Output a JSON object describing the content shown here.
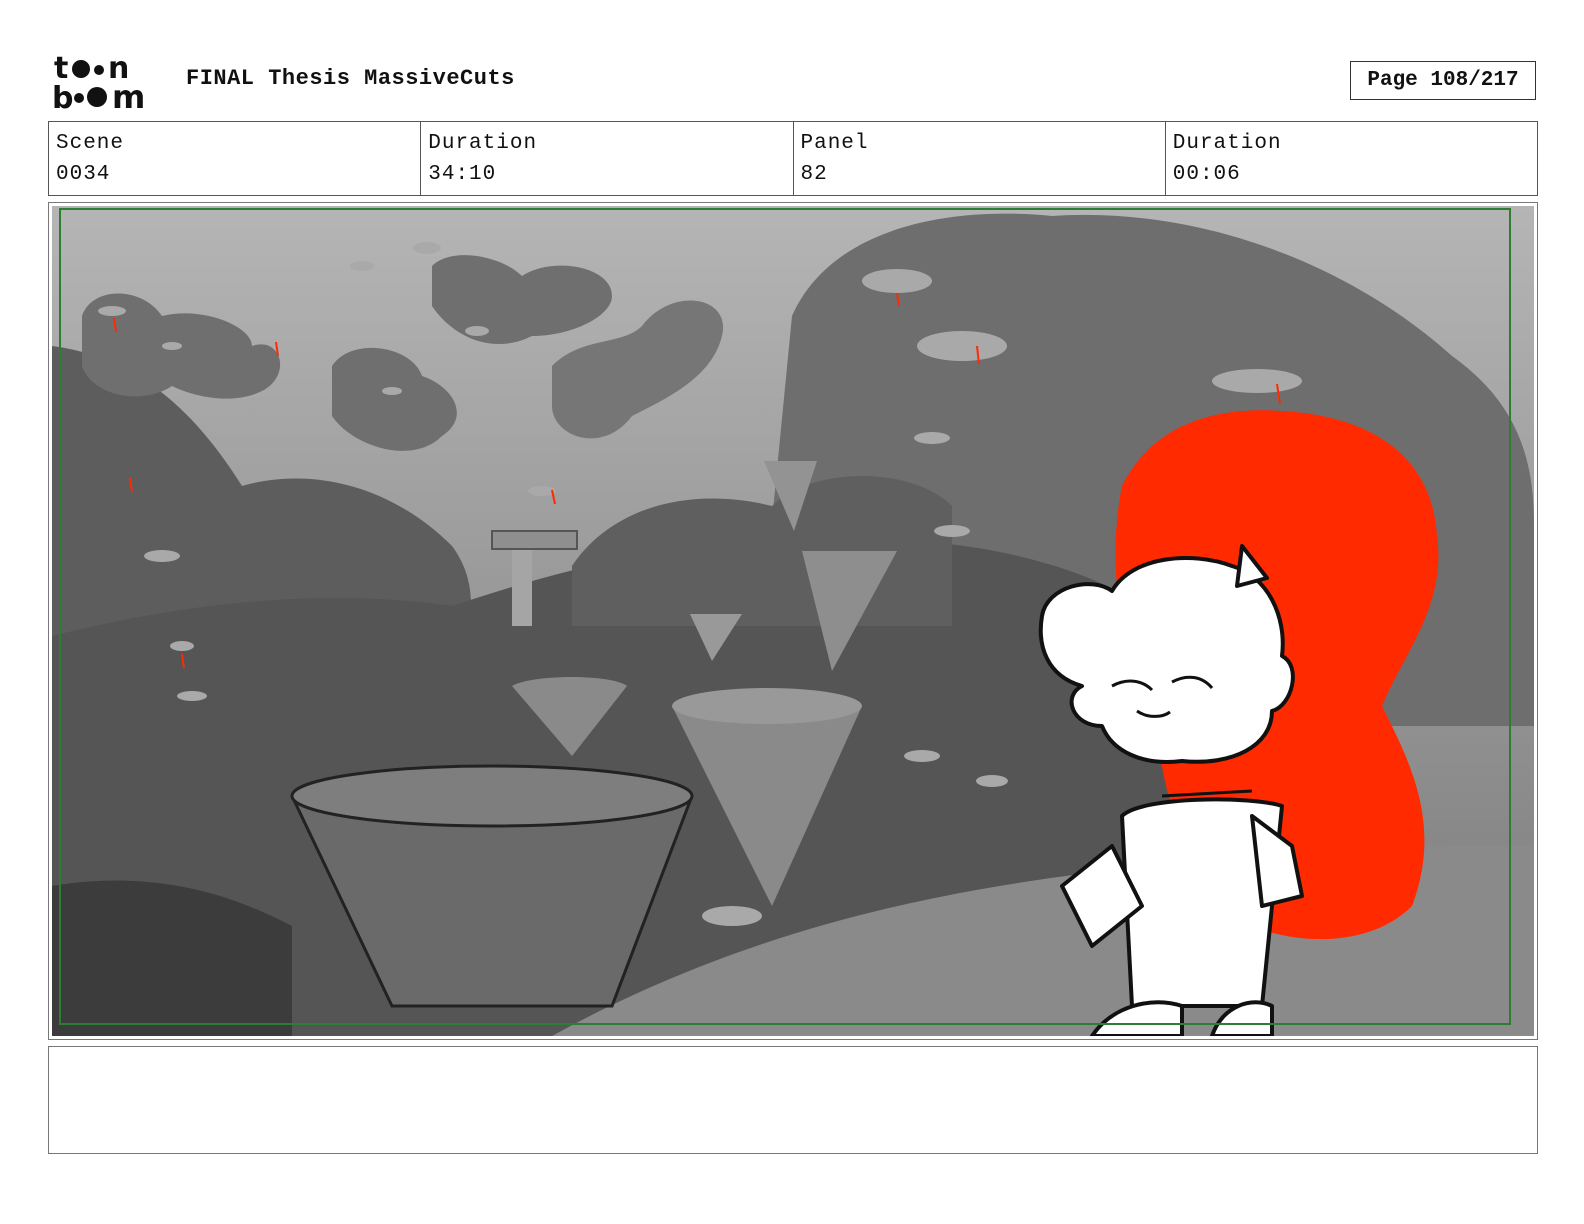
{
  "header": {
    "logo_text": "toon boom",
    "title": "FINAL Thesis MassiveCuts",
    "page_label": "Page 108/217"
  },
  "info": [
    {
      "label": "Scene",
      "value": "0034"
    },
    {
      "label": "Duration",
      "value": "34:10"
    },
    {
      "label": "Panel",
      "value": "82"
    },
    {
      "label": "Duration",
      "value": "00:06"
    }
  ],
  "panel": {
    "description_icon": "storyboard-sketch",
    "accent_color": "#ff2a00",
    "safe_frame_color": "#2e7d32"
  },
  "notes": {
    "text": ""
  }
}
